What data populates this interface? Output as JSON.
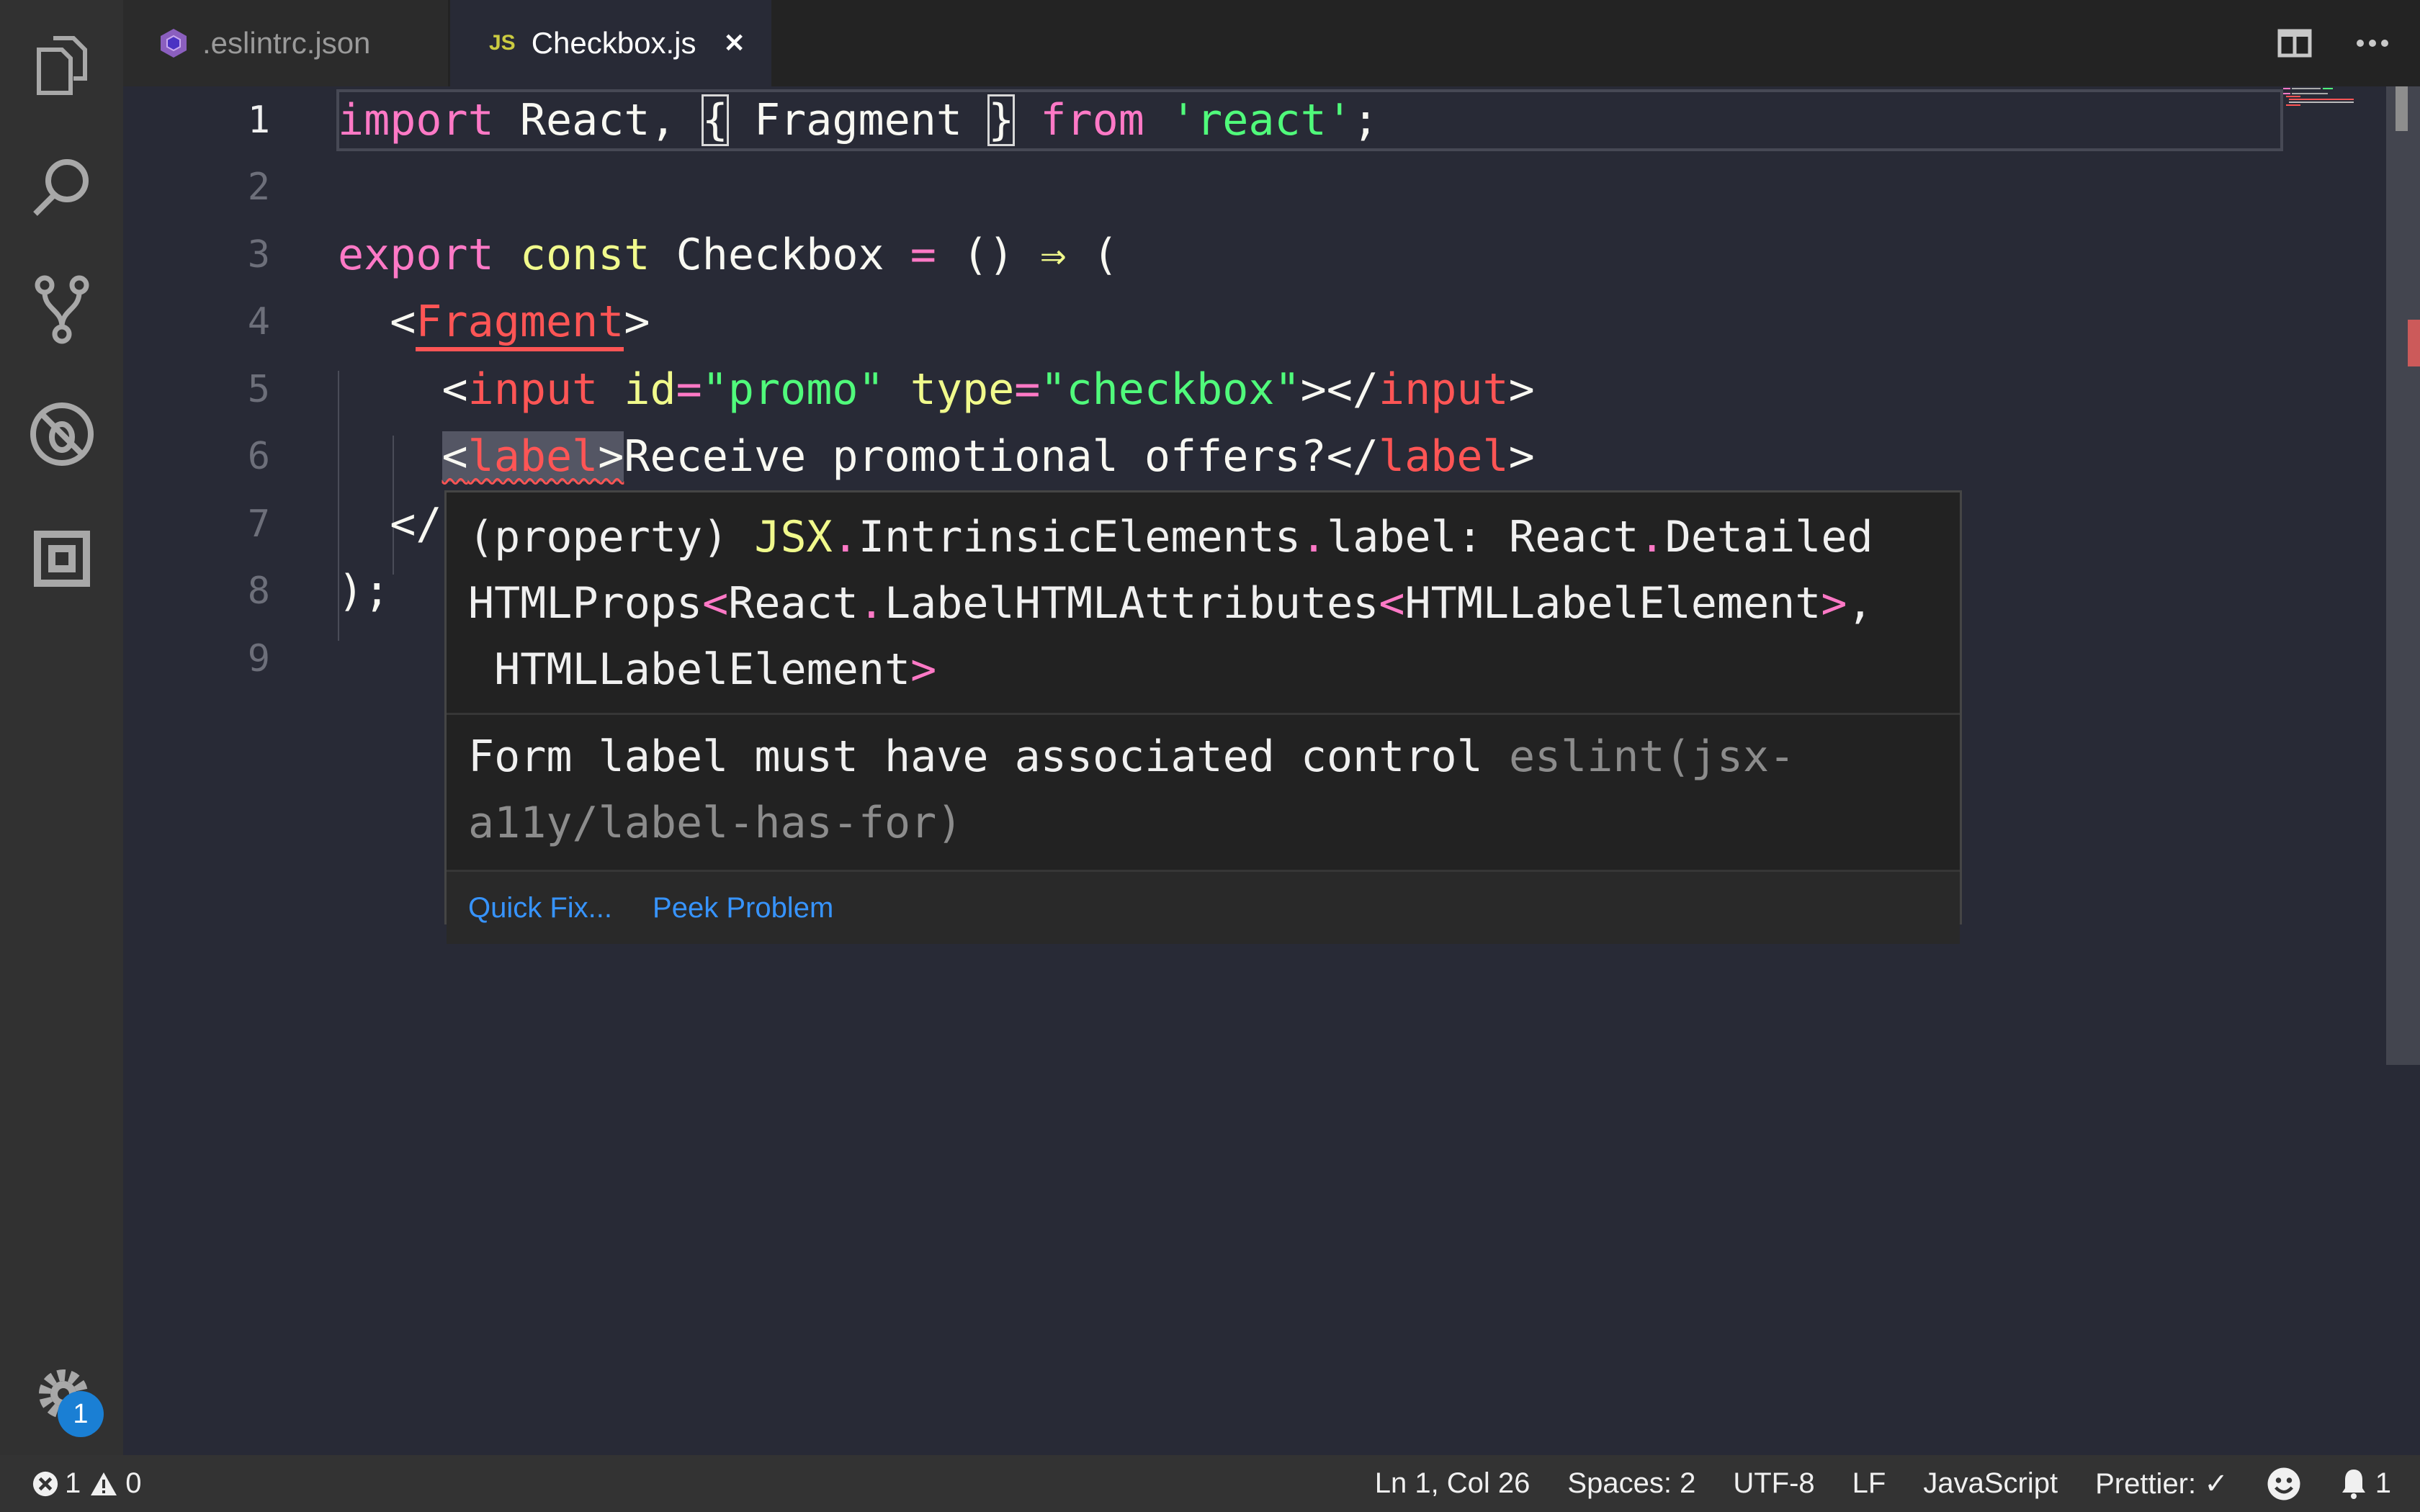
{
  "tabs": [
    {
      "label": ".eslintrc.json",
      "icon": "eslint-icon",
      "active": false
    },
    {
      "label": "Checkbox.js",
      "icon_text": "JS",
      "active": true,
      "close": "✕"
    }
  ],
  "activity_bar": {
    "items": [
      "explorer-icon",
      "search-icon",
      "source-control-icon",
      "debug-icon",
      "extensions-icon"
    ],
    "settings_badge": "1"
  },
  "editor": {
    "lines": [
      {
        "n": "1",
        "tokens": [
          [
            "kw",
            "import"
          ],
          [
            "plain",
            " React, "
          ],
          [
            "bracket",
            "{"
          ],
          [
            "plain",
            " Fragment "
          ],
          [
            "bracket",
            "}"
          ],
          [
            "plain",
            " "
          ],
          [
            "kw",
            "from"
          ],
          [
            "plain",
            " "
          ],
          [
            "str",
            "'react'"
          ],
          [
            "plain",
            ";"
          ]
        ]
      },
      {
        "n": "2",
        "tokens": []
      },
      {
        "n": "3",
        "tokens": [
          [
            "kw",
            "export"
          ],
          [
            "plain",
            " "
          ],
          [
            "decl",
            "const"
          ],
          [
            "plain",
            " Checkbox "
          ],
          [
            "op",
            "="
          ],
          [
            "plain",
            " () "
          ],
          [
            "arrow",
            "⇒"
          ],
          [
            "plain",
            " ("
          ]
        ]
      },
      {
        "n": "4",
        "tokens": [
          [
            "plain",
            "  <"
          ],
          [
            "tag-under",
            "Fragment"
          ],
          [
            "plain",
            ">"
          ]
        ]
      },
      {
        "n": "5",
        "tokens": [
          [
            "plain",
            "    <"
          ],
          [
            "tag",
            "input"
          ],
          [
            "plain",
            " "
          ],
          [
            "attr",
            "id"
          ],
          [
            "op",
            "="
          ],
          [
            "str",
            "\"promo\""
          ],
          [
            "plain",
            " "
          ],
          [
            "attr",
            "type"
          ],
          [
            "op",
            "="
          ],
          [
            "str",
            "\"checkbox\""
          ],
          [
            "plain",
            "></"
          ],
          [
            "tag",
            "input"
          ],
          [
            "plain",
            ">"
          ]
        ]
      },
      {
        "n": "6",
        "tokens": [
          [
            "plain",
            "    "
          ],
          [
            "sel-open",
            "<"
          ],
          [
            "sel-tag",
            "label"
          ],
          [
            "sel-close",
            ">"
          ],
          [
            "plain",
            "Receive promotional offers?</"
          ],
          [
            "tag",
            "label"
          ],
          [
            "plain",
            ">"
          ]
        ]
      },
      {
        "n": "7",
        "tokens": [
          [
            "plain",
            "  </"
          ]
        ]
      },
      {
        "n": "8",
        "tokens": [
          [
            "plain",
            ");"
          ]
        ]
      },
      {
        "n": "9",
        "tokens": []
      }
    ]
  },
  "hover": {
    "signature": [
      [
        [
          "plain",
          "(property) "
        ],
        [
          "decl",
          "JSX"
        ],
        [
          "op",
          "."
        ],
        [
          "plain",
          "IntrinsicElements"
        ],
        [
          "op",
          "."
        ],
        [
          "plain",
          "label: React"
        ],
        [
          "op",
          "."
        ],
        [
          "plain",
          "Detailed"
        ]
      ],
      [
        [
          "plain",
          "HTMLProps"
        ],
        [
          "op",
          "<"
        ],
        [
          "plain",
          "React"
        ],
        [
          "op",
          "."
        ],
        [
          "plain",
          "LabelHTMLAttributes"
        ],
        [
          "op",
          "<"
        ],
        [
          "plain",
          "HTMLLabelElement"
        ],
        [
          "op",
          ">"
        ],
        [
          "plain",
          ","
        ]
      ],
      [
        [
          "plain",
          " HTMLLabelElement"
        ],
        [
          "op",
          ">"
        ]
      ]
    ],
    "message": "Form label must have associated control",
    "source_line1": "eslint(jsx-",
    "source_line2": "a11y/label-has-for)",
    "actions": {
      "quick_fix": "Quick Fix...",
      "peek_problem": "Peek Problem"
    }
  },
  "status_bar": {
    "errors": "1",
    "warnings": "0",
    "position": "Ln 1, Col 26",
    "spaces": "Spaces: 2",
    "encoding": "UTF-8",
    "eol": "LF",
    "language": "JavaScript",
    "prettier": "Prettier: ✓",
    "notifications": "1"
  },
  "colors": {
    "keyword": "#ff79c6",
    "string": "#50fa7b",
    "tag": "#ff5555",
    "decl": "#f1fa8c",
    "editor_bg": "#282a36",
    "link": "#3794ff",
    "badge": "#1a7fd4"
  }
}
